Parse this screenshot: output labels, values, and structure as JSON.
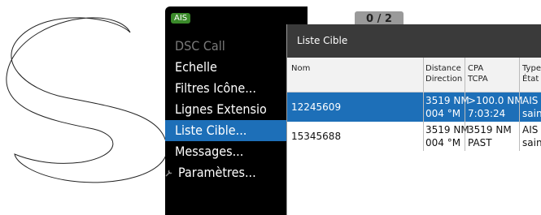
{
  "ais_panel": {
    "badge": "AIS",
    "counter": "0 / 2",
    "menu": [
      {
        "label": "DSC Call",
        "state": "disabled"
      },
      {
        "label": "Echelle",
        "state": "normal"
      },
      {
        "label": "Filtres Icône...",
        "state": "normal"
      },
      {
        "label": "Lignes Extensio",
        "state": "normal"
      },
      {
        "label": "Liste Cible...",
        "state": "selected"
      },
      {
        "label": "Messages...",
        "state": "normal"
      },
      {
        "label": "Paramètres...",
        "state": "normal",
        "icon": "wrench-icon"
      }
    ]
  },
  "target_list": {
    "title": "Liste Cible",
    "headers": {
      "name": "Nom",
      "distance": "Distance",
      "direction": "Direction",
      "cpa": "CPA",
      "tcpa": "TCPA",
      "type": "Type",
      "etat": "État"
    },
    "rows": [
      {
        "name": "12245609",
        "distance": "3519 NM",
        "direction": "004 °M",
        "cpa": ">100.0 NM",
        "tcpa": "7:03:24",
        "type": "AIS",
        "etat": "sain",
        "selected": true
      },
      {
        "name": "15345688",
        "distance": "3519 NM",
        "direction": "004 °M",
        "cpa": "3519 NM",
        "tcpa": "PAST",
        "type": "AIS",
        "etat": "sain",
        "selected": false
      }
    ]
  },
  "colors": {
    "selection": "#1d6fb8",
    "badge": "#3a8a2a",
    "panel": "#000000",
    "title_bar": "#3a3a3a"
  }
}
